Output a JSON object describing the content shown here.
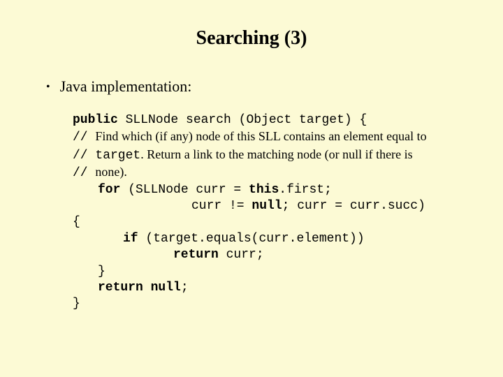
{
  "title": "Searching (3)",
  "bullet": "Java implementation:",
  "code": {
    "l1_kw_public": "public",
    "l1_rest": " SLLNode search (Object target) {",
    "l2_slashes": "// ",
    "l2_text": "Find which (if any) node of this SLL contains an element equal to",
    "l3_slashes": "// ",
    "l3_pre": "target",
    "l3_text": ". Return a link to the matching node (or null if there is",
    "l4_slashes": "// ",
    "l4_text": "none).",
    "l5_kw_for": "for",
    "l5_mid": " (SLLNode curr = ",
    "l5_kw_this": "this",
    "l5_end": ".first;",
    "l6_mid": "curr != ",
    "l6_kw_null": "null",
    "l6_end": "; curr = curr.succ)",
    "l7": "{",
    "l8_kw_if": "if",
    "l8_rest": " (target.equals(curr.element))",
    "l9_kw_return": "return",
    "l9_rest": " curr;",
    "l10": "}",
    "l11_kw_return": "return",
    "l11_kw_null": " null",
    "l11_end": ";",
    "l12": "}"
  }
}
